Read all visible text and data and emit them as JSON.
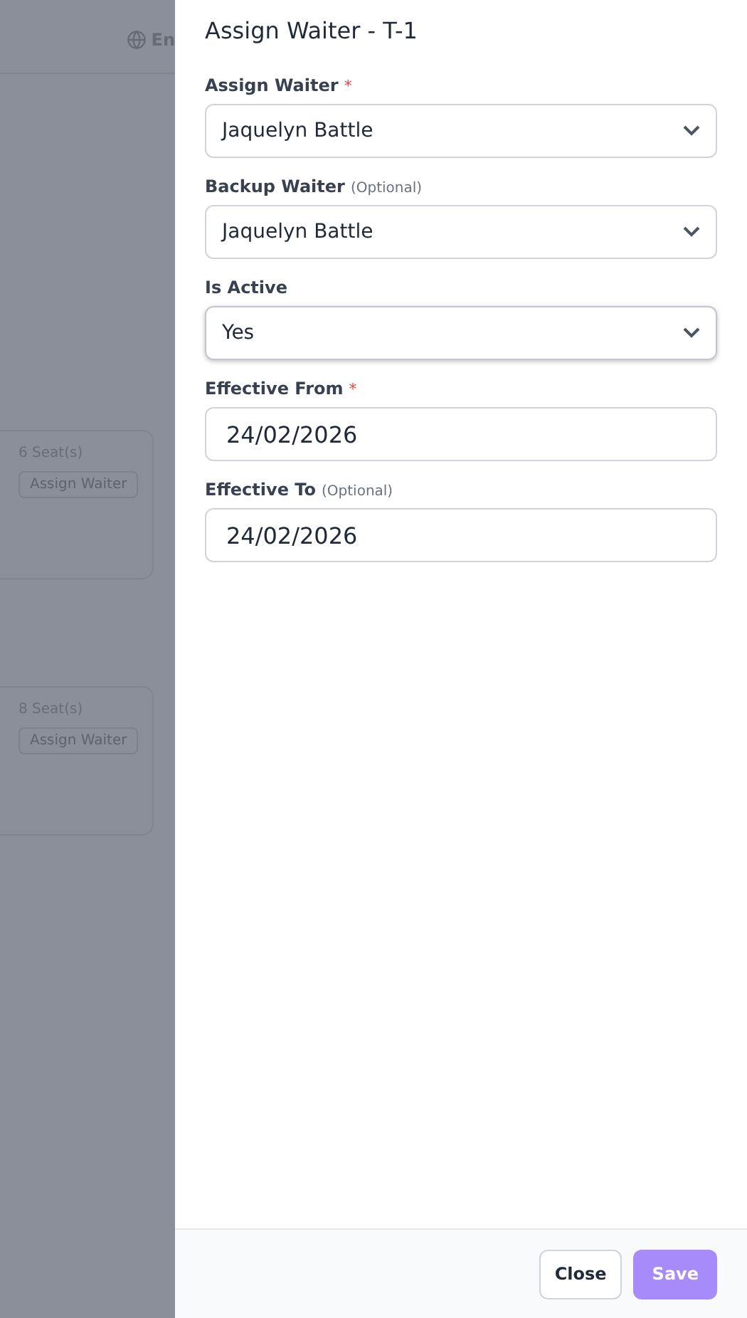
{
  "background": {
    "language": "En",
    "tables": [
      {
        "seats": "6 Seat(s)",
        "action": "Assign Waiter"
      },
      {
        "seats": "8 Seat(s)",
        "action": "Assign Waiter"
      }
    ]
  },
  "drawer": {
    "title": "Assign Waiter - T-1",
    "fields": [
      {
        "kind": "select",
        "label": "Assign Waiter",
        "required_mark": "*",
        "value": "Jaquelyn Battle",
        "focused": false
      },
      {
        "kind": "select",
        "label": "Backup Waiter",
        "note": "(Optional)",
        "value": "Jaquelyn Battle",
        "focused": false
      },
      {
        "kind": "select",
        "label": "Is Active",
        "value": "Yes",
        "focused": true
      },
      {
        "kind": "date",
        "label": "Effective From",
        "required_mark": "*",
        "value": "24/02/2026",
        "focused": false
      },
      {
        "kind": "date",
        "label": "Effective To",
        "note": "(Optional)",
        "value": "24/02/2026",
        "focused": false
      }
    ],
    "buttons": [
      {
        "label": "Close",
        "kind": "secondary",
        "disabled": false
      },
      {
        "label": "Save",
        "kind": "primary",
        "disabled": true
      }
    ]
  }
}
